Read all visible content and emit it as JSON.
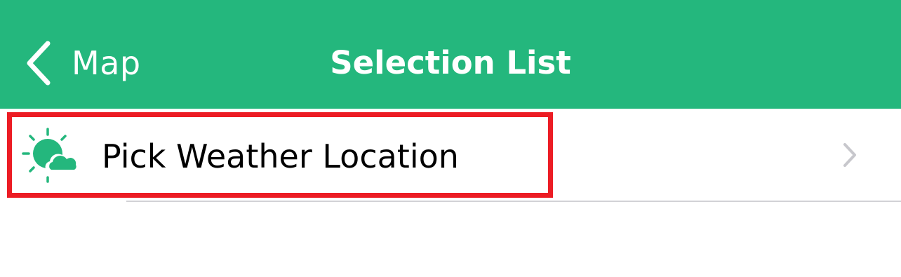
{
  "navbar": {
    "back_label": "Map",
    "title": "Selection List",
    "background_color": "#24b77d",
    "back_icon": "chevron-left-icon"
  },
  "list": {
    "items": [
      {
        "label": "Pick Weather Location",
        "icon": "weather-partly-cloudy-icon",
        "icon_color": "#24b77d",
        "accessory_icon": "chevron-right-icon"
      }
    ]
  },
  "annotation": {
    "highlight_color": "#ec1c24"
  }
}
